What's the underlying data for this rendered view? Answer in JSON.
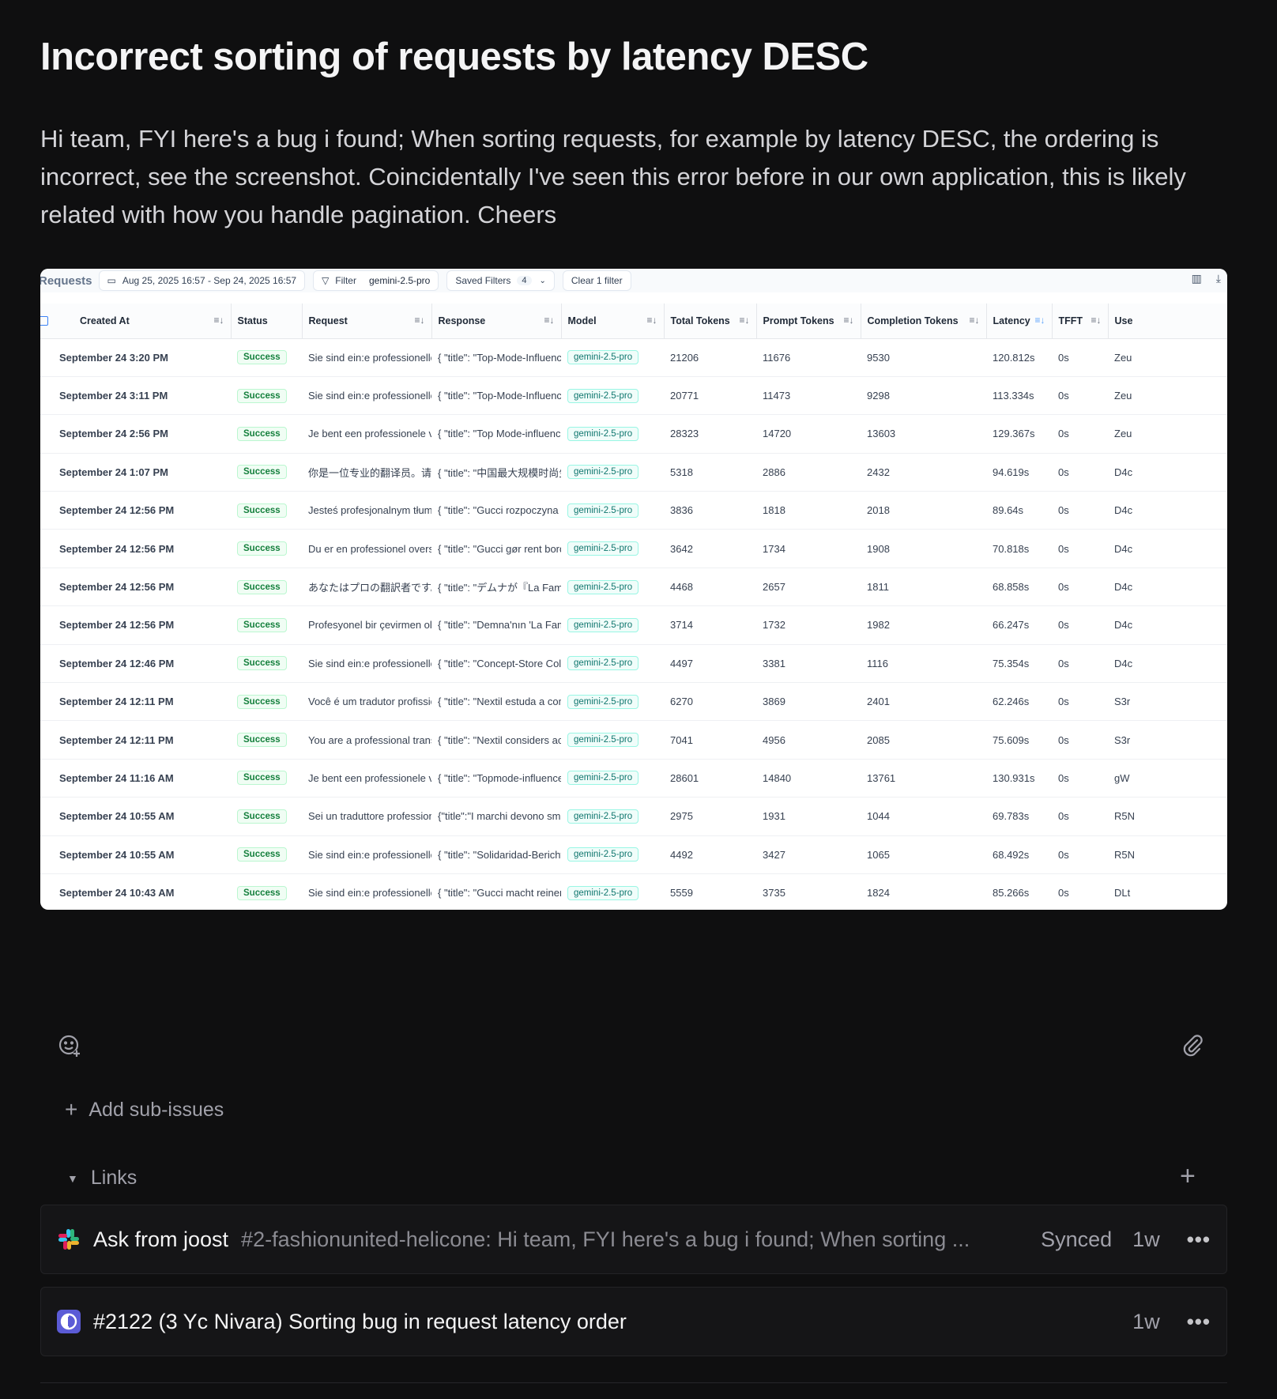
{
  "issue": {
    "title": "Incorrect sorting of requests by latency DESC",
    "description": "Hi team, FYI here's a bug i found; When sorting requests, for example by latency DESC, the ordering is incorrect, see the screenshot. Coincidentally I've seen this error before in our own application, this is likely related with how you handle pagination. Cheers"
  },
  "screenshot": {
    "toolbar": {
      "title": "Requests",
      "date_range": "Aug 25, 2025 16:57 - Sep 24, 2025 16:57",
      "filter_label": "Filter",
      "filter_value": "gemini-2.5-pro",
      "saved_filters_label": "Saved Filters",
      "saved_filters_count": "4",
      "clear_filter_label": "Clear 1 filter"
    },
    "columns": [
      "Created At",
      "Status",
      "Request",
      "Response",
      "Model",
      "Total Tokens",
      "Prompt Tokens",
      "Completion Tokens",
      "Latency",
      "TFFT",
      "Use"
    ],
    "rows": [
      {
        "created": "September 24 3:20 PM",
        "status": "Success",
        "request": "Sie sind ein:e professionelle:r",
        "response": "{ \"title\": \"Top-Mode-Influence",
        "model": "gemini-2.5-pro",
        "total": "21206",
        "prompt": "11676",
        "completion": "9530",
        "latency": "120.812s",
        "tfft": "0s",
        "user": "Zeu"
      },
      {
        "created": "September 24 3:11 PM",
        "status": "Success",
        "request": "Sie sind ein:e professionelle:r",
        "response": "{ \"title\": \"Top-Mode-Influence",
        "model": "gemini-2.5-pro",
        "total": "20771",
        "prompt": "11473",
        "completion": "9298",
        "latency": "113.334s",
        "tfft": "0s",
        "user": "Zeu"
      },
      {
        "created": "September 24 2:56 PM",
        "status": "Success",
        "request": "Je bent een professionele ve",
        "response": "{ \"title\": \"Top Mode-influence",
        "model": "gemini-2.5-pro",
        "total": "28323",
        "prompt": "14720",
        "completion": "13603",
        "latency": "129.367s",
        "tfft": "0s",
        "user": "Zeu"
      },
      {
        "created": "September 24 1:07 PM",
        "status": "Success",
        "request": "你是一位专业的翻译员。请将以",
        "response": "{ \"title\": \"中国最大规模时尚生活",
        "model": "gemini-2.5-pro",
        "total": "5318",
        "prompt": "2886",
        "completion": "2432",
        "latency": "94.619s",
        "tfft": "0s",
        "user": "D4c"
      },
      {
        "created": "September 24 12:56 PM",
        "status": "Success",
        "request": "Jesteś profesjonalnym tłumac",
        "response": "{ \"title\": \"Gucci rozpoczyna n",
        "model": "gemini-2.5-pro",
        "total": "3836",
        "prompt": "1818",
        "completion": "2018",
        "latency": "89.64s",
        "tfft": "0s",
        "user": "D4c"
      },
      {
        "created": "September 24 12:56 PM",
        "status": "Success",
        "request": "Du er en professionel oversæ",
        "response": "{ \"title\": \"Gucci gør rent bord",
        "model": "gemini-2.5-pro",
        "total": "3642",
        "prompt": "1734",
        "completion": "1908",
        "latency": "70.818s",
        "tfft": "0s",
        "user": "D4c"
      },
      {
        "created": "September 24 12:56 PM",
        "status": "Success",
        "request": "あなたはプロの翻訳者です。以",
        "response": "{ \"title\": \"デムナが『La Famigl",
        "model": "gemini-2.5-pro",
        "total": "4468",
        "prompt": "2657",
        "completion": "1811",
        "latency": "68.858s",
        "tfft": "0s",
        "user": "D4c"
      },
      {
        "created": "September 24 12:56 PM",
        "status": "Success",
        "request": "Profesyonel bir çevirmen olar",
        "response": "{ \"title\": \"Demna'nın 'La Fami",
        "model": "gemini-2.5-pro",
        "total": "3714",
        "prompt": "1732",
        "completion": "1982",
        "latency": "66.247s",
        "tfft": "0s",
        "user": "D4c"
      },
      {
        "created": "September 24 12:46 PM",
        "status": "Success",
        "request": "Sie sind ein:e professionelle:r",
        "response": "{ \"title\": \"Concept-Store Cole",
        "model": "gemini-2.5-pro",
        "total": "4497",
        "prompt": "3381",
        "completion": "1116",
        "latency": "75.354s",
        "tfft": "0s",
        "user": "D4c"
      },
      {
        "created": "September 24 12:11 PM",
        "status": "Success",
        "request": "Você é um tradutor profissior",
        "response": "{ \"title\": \"Nextil estuda a com",
        "model": "gemini-2.5-pro",
        "total": "6270",
        "prompt": "3869",
        "completion": "2401",
        "latency": "62.246s",
        "tfft": "0s",
        "user": "S3r"
      },
      {
        "created": "September 24 12:11 PM",
        "status": "Success",
        "request": "You are a professional transla",
        "response": "{ \"title\": \"Nextil considers acc",
        "model": "gemini-2.5-pro",
        "total": "7041",
        "prompt": "4956",
        "completion": "2085",
        "latency": "75.609s",
        "tfft": "0s",
        "user": "S3r"
      },
      {
        "created": "September 24 11:16 AM",
        "status": "Success",
        "request": "Je bent een professionele ve",
        "response": "{ \"title\": \"Topmode-influence",
        "model": "gemini-2.5-pro",
        "total": "28601",
        "prompt": "14840",
        "completion": "13761",
        "latency": "130.931s",
        "tfft": "0s",
        "user": "gW"
      },
      {
        "created": "September 24 10:55 AM",
        "status": "Success",
        "request": "Sei un traduttore professionis",
        "response": "{\"title\":\"I marchi devono smet",
        "model": "gemini-2.5-pro",
        "total": "2975",
        "prompt": "1931",
        "completion": "1044",
        "latency": "69.783s",
        "tfft": "0s",
        "user": "R5N"
      },
      {
        "created": "September 24 10:55 AM",
        "status": "Success",
        "request": "Sie sind ein:e professionelle:r",
        "response": "{ \"title\": \"Solidaridad-Bericht:",
        "model": "gemini-2.5-pro",
        "total": "4492",
        "prompt": "3427",
        "completion": "1065",
        "latency": "68.492s",
        "tfft": "0s",
        "user": "R5N"
      },
      {
        "created": "September 24 10:43 AM",
        "status": "Success",
        "request": "Sie sind ein:e professionelle:r",
        "response": "{ \"title\": \"Gucci macht reinen",
        "model": "gemini-2.5-pro",
        "total": "5559",
        "prompt": "3735",
        "completion": "1824",
        "latency": "85.266s",
        "tfft": "0s",
        "user": "DLt"
      }
    ]
  },
  "controls": {
    "add_sub_issues": "Add sub-issues",
    "links_label": "Links"
  },
  "links": [
    {
      "icon": "slack-icon",
      "title": "Ask from joost",
      "subtitle": "#2-fashionunited-helicone: Hi team, FYI here's a bug i found; When sorting ...",
      "sync": "Synced",
      "time": "1w"
    },
    {
      "icon": "linear-icon",
      "title": "#2122 (3 Yc Nivara) Sorting bug in request latency order",
      "subtitle": "",
      "sync": "",
      "time": "1w"
    }
  ],
  "colors": {
    "background": "#0f0f10",
    "success": "#15803d",
    "model_badge": "#0f766e",
    "active_sort": "#60a5fa"
  }
}
